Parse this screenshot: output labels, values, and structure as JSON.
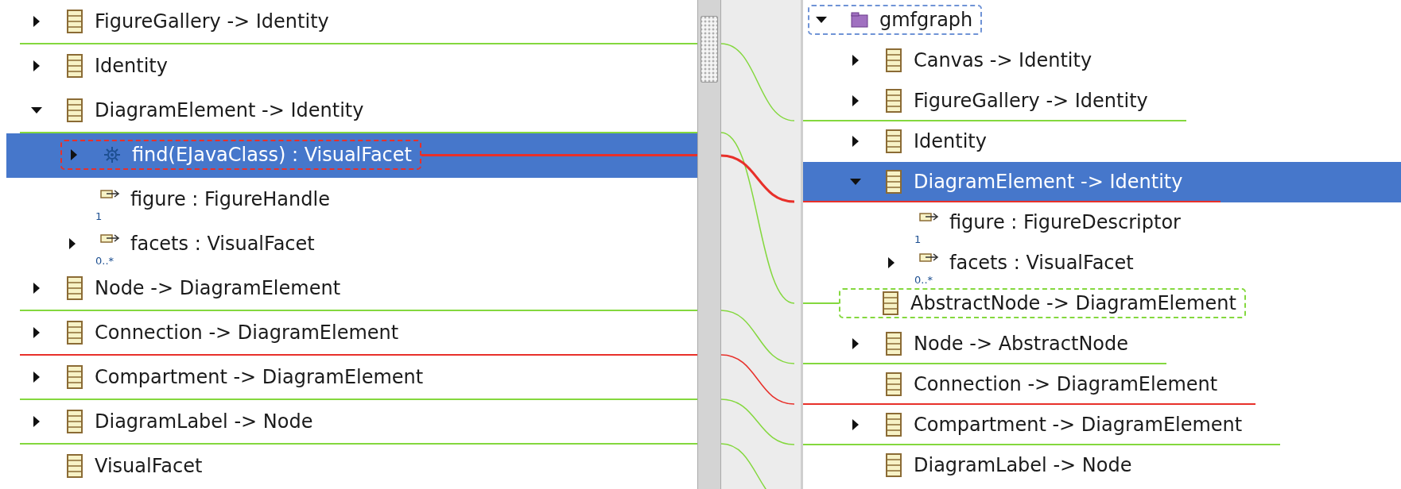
{
  "left_tree": {
    "items": [
      {
        "label": "FigureGallery -> Identity",
        "kind": "class",
        "expanded": false,
        "selected": false,
        "diff": {
          "kind": "line",
          "color": "#84d83e"
        }
      },
      {
        "label": "Identity",
        "kind": "class",
        "expanded": false,
        "selected": false
      },
      {
        "label": "DiagramElement -> Identity",
        "kind": "class",
        "expanded": true,
        "selected": false,
        "diff": {
          "kind": "line",
          "color": "#84d83e"
        },
        "children": [
          {
            "label": "find(EJavaClass) : VisualFacet",
            "kind": "operation",
            "expanded": false,
            "selected": true,
            "diff": {
              "kind": "box",
              "color": "#e8302a",
              "linked": true
            }
          },
          {
            "label": "figure : FigureHandle",
            "kind": "reference",
            "multiplicity": "1",
            "selected": false
          },
          {
            "label": "facets : VisualFacet",
            "kind": "reference",
            "multiplicity": "0..*",
            "expanded": false,
            "selected": false
          }
        ]
      },
      {
        "label": "Node -> DiagramElement",
        "kind": "class",
        "expanded": false,
        "selected": false,
        "diff": {
          "kind": "line",
          "color": "#84d83e"
        }
      },
      {
        "label": "Connection -> DiagramElement",
        "kind": "class",
        "expanded": false,
        "selected": false,
        "diff": {
          "kind": "line",
          "color": "#e8302a"
        }
      },
      {
        "label": "Compartment -> DiagramElement",
        "kind": "class",
        "expanded": false,
        "selected": false,
        "diff": {
          "kind": "line",
          "color": "#84d83e"
        }
      },
      {
        "label": "DiagramLabel -> Node",
        "kind": "class",
        "expanded": false,
        "selected": false,
        "diff": {
          "kind": "line",
          "color": "#84d83e"
        }
      },
      {
        "label": "VisualFacet",
        "kind": "class",
        "selected": false
      }
    ]
  },
  "right_tree": {
    "items": [
      {
        "label": "gmfgraph",
        "kind": "package",
        "expanded": true,
        "selected": false,
        "diff": {
          "kind": "box",
          "color": "#6f93d6",
          "linked": false
        },
        "children": [
          {
            "label": "Canvas -> Identity",
            "kind": "class",
            "expanded": false,
            "selected": false
          },
          {
            "label": "FigureGallery -> Identity",
            "kind": "class",
            "expanded": false,
            "selected": false,
            "diff": {
              "kind": "line",
              "color": "#84d83e"
            }
          },
          {
            "label": "Identity",
            "kind": "class",
            "expanded": false,
            "selected": false
          },
          {
            "label": "DiagramElement -> Identity",
            "kind": "class",
            "expanded": true,
            "selected": true,
            "diff": {
              "kind": "line",
              "color": "#e8302a"
            },
            "children": [
              {
                "label": "figure : FigureDescriptor",
                "kind": "reference",
                "multiplicity": "1",
                "selected": false
              },
              {
                "label": "facets : VisualFacet",
                "kind": "reference",
                "multiplicity": "0..*",
                "expanded": false,
                "selected": false
              }
            ]
          },
          {
            "label": "AbstractNode -> DiagramElement",
            "kind": "class",
            "selected": false,
            "diff": {
              "kind": "box",
              "color": "#84d83e",
              "linked": true
            }
          },
          {
            "label": "Node -> AbstractNode",
            "kind": "class",
            "expanded": false,
            "selected": false,
            "diff": {
              "kind": "line",
              "color": "#84d83e"
            }
          },
          {
            "label": "Connection -> DiagramElement",
            "kind": "class",
            "selected": false,
            "diff": {
              "kind": "line",
              "color": "#e8302a"
            }
          },
          {
            "label": "Compartment -> DiagramElement",
            "kind": "class",
            "expanded": false,
            "selected": false,
            "diff": {
              "kind": "line",
              "color": "#84d83e"
            }
          },
          {
            "label": "DiagramLabel -> Node",
            "kind": "class",
            "selected": false
          }
        ]
      }
    ]
  }
}
